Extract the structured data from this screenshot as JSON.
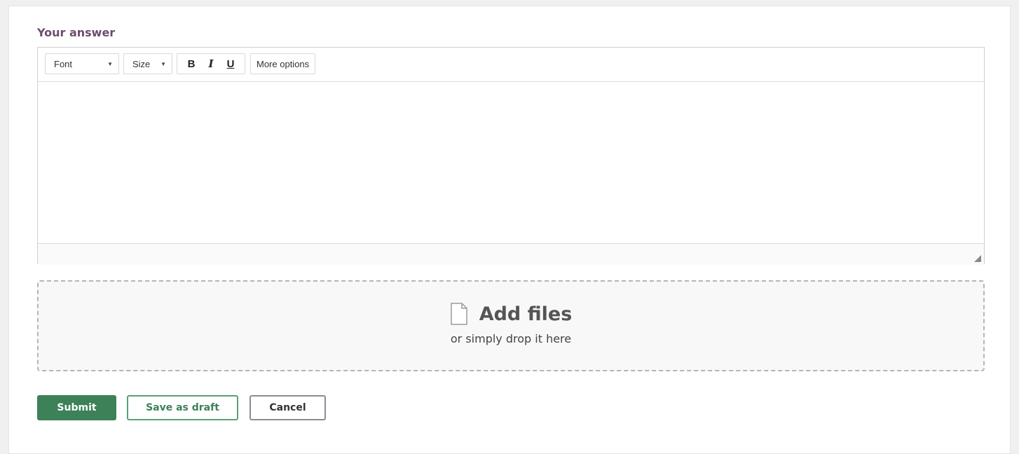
{
  "form": {
    "label": "Your answer"
  },
  "toolbar": {
    "font_label": "Font",
    "size_label": "Size",
    "bold_label": "B",
    "italic_label": "I",
    "underline_label": "U",
    "more_label": "More options"
  },
  "dropzone": {
    "title": "Add files",
    "subtitle": "or simply drop it here",
    "icon": "file-icon"
  },
  "actions": {
    "submit_label": "Submit",
    "draft_label": "Save as draft",
    "cancel_label": "Cancel"
  },
  "colors": {
    "label": "#6b4e6b",
    "primary": "#3c8158",
    "cancel_border": "#8f8a96"
  }
}
